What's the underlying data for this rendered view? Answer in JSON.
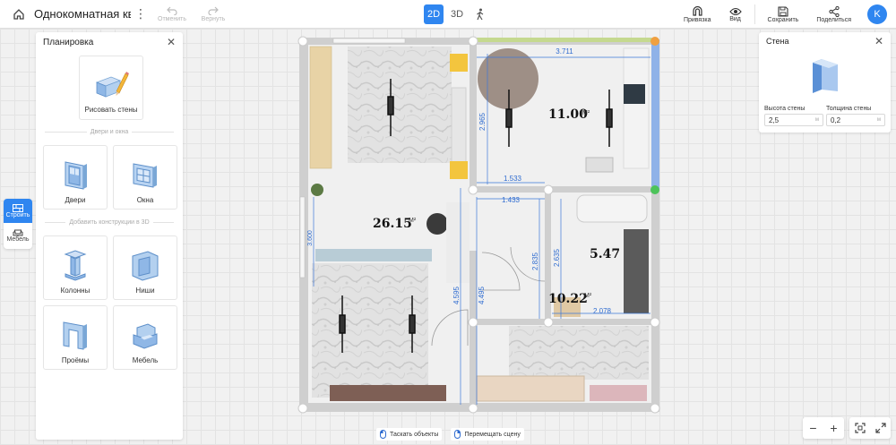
{
  "topbar": {
    "project_title": "Однокомнатная ква",
    "undo_label": "Отменить",
    "redo_label": "Вернуть",
    "mode_2d": "2D",
    "mode_3d": "3D",
    "snap_label": "Привязка",
    "view_label": "Вид",
    "save_label": "Сохранить",
    "share_label": "Поделиться",
    "avatar_letter": "K",
    "accent": "#2f86f0"
  },
  "rail": {
    "build_label": "Строить",
    "furniture_label": "Мебель"
  },
  "left_panel": {
    "title": "Планировка",
    "draw_walls": "Рисовать стены",
    "section_doors": "Двери и окна",
    "doors": "Двери",
    "windows": "Окна",
    "section_constructions": "Добавить конструкции в 3D",
    "columns": "Колонны",
    "niches": "Ниши",
    "openings": "Проёмы",
    "furniture": "Мебель"
  },
  "right_panel": {
    "title": "Стена",
    "height_label": "Высота стены",
    "height_value": "2,5",
    "height_unit": "м",
    "thickness_label": "Толщина стены",
    "thickness_value": "0,2",
    "thickness_unit": "м"
  },
  "plan": {
    "area_main": "26.15",
    "area_bedroom": "11.00",
    "area_bath": "5.47",
    "area_hall": "10.22",
    "area_unit": "M²",
    "dims": {
      "top": "3.711",
      "kitchen_height": "2.965",
      "kitchen_width": "1.533",
      "hall_width": "1.433",
      "bath_height_a": "2.835",
      "bath_height_b": "2.635",
      "bath_width": "2.078",
      "mid_height": "4.595",
      "hall_height": "4.495",
      "left_height": "3.600"
    }
  },
  "bottom": {
    "drag_objects": "Таскать объекты",
    "move_scene": "Перемещать сцену"
  }
}
